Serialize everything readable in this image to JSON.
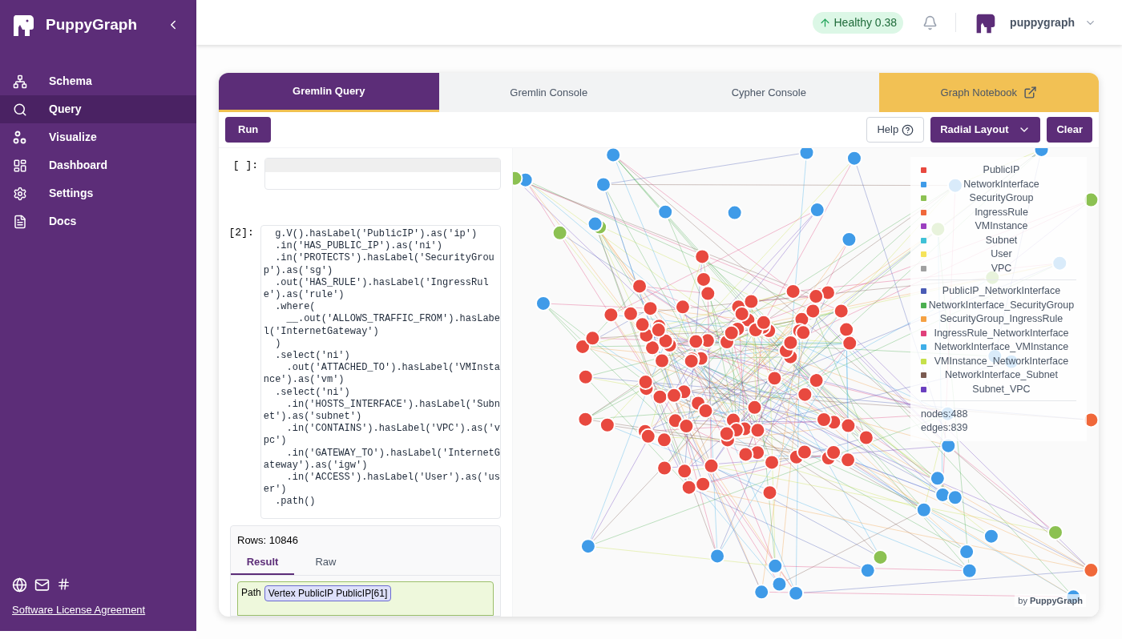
{
  "sidebar": {
    "brand": "PuppyGraph",
    "items": [
      {
        "label": "Schema",
        "selected": false
      },
      {
        "label": "Query",
        "selected": true
      },
      {
        "label": "Visualize",
        "selected": false
      },
      {
        "label": "Dashboard",
        "selected": false
      },
      {
        "label": "Settings",
        "selected": false
      },
      {
        "label": "Docs",
        "selected": false
      }
    ],
    "footer_link": "Software License Agreement"
  },
  "header": {
    "status": "Healthy 0.38",
    "user": "puppygraph"
  },
  "tabs": [
    {
      "label": "Gremlin Query",
      "selected": true,
      "kind": "tab"
    },
    {
      "label": "Gremlin Console",
      "selected": false,
      "kind": "tab"
    },
    {
      "label": "Cypher Console",
      "selected": false,
      "kind": "tab"
    },
    {
      "label": "Graph Notebook",
      "selected": false,
      "kind": "external"
    }
  ],
  "toolbar": {
    "run": "Run",
    "help": "Help",
    "layout": "Radial Layout",
    "clear": "Clear"
  },
  "cells": [
    {
      "prompt": "[ ]:"
    },
    {
      "prompt": "[2]:",
      "lines": [
        "  g.V().hasLabel('PublicIP').as('ip')",
        "  .in('HAS_PUBLIC_IP').as('ni')",
        "  .in('PROTECTS').hasLabel('SecurityGrou",
        "p').as('sg')",
        "  .out('HAS_RULE').hasLabel('IngressRul",
        "e').as('rule')",
        "  .where(",
        "    __.out('ALLOWS_TRAFFIC_FROM').hasLabe",
        "l('InternetGateway')",
        "  )",
        "  .select('ni')",
        "    .out('ATTACHED_TO').hasLabel('VMInsta",
        "nce').as('vm')",
        "  .select('ni')",
        "    .in('HOSTS_INTERFACE').hasLabel('Subn",
        "et').as('subnet')",
        "    .in('CONTAINS').hasLabel('VPC').as('v",
        "pc')",
        "    .in('GATEWAY_TO').hasLabel('InternetG",
        "ateway').as('igw')",
        "    .in('ACCESS').hasLabel('User').as('us",
        "er')",
        "  .path()"
      ]
    }
  ],
  "result": {
    "rows": "Rows: 10846",
    "tabs": [
      {
        "label": "Result",
        "selected": true
      },
      {
        "label": "Raw",
        "selected": false
      }
    ],
    "path_label": "Path",
    "chips": [
      "Vertex PublicIP PublicIP[61]"
    ]
  },
  "legend": {
    "vertices": [
      {
        "label": "PublicIP",
        "color": "#e8493f"
      },
      {
        "label": "NetworkInterface",
        "color": "#3f9be8"
      },
      {
        "label": "SecurityGroup",
        "color": "#8cc152"
      },
      {
        "label": "IngressRule",
        "color": "#f0683a"
      },
      {
        "label": "VMInstance",
        "color": "#9b3fbf"
      },
      {
        "label": "Subnet",
        "color": "#3fc1d6"
      },
      {
        "label": "User",
        "color": "#f5e35a"
      },
      {
        "label": "VPC",
        "color": "#a0a0a0"
      }
    ],
    "edges": [
      {
        "label": "PublicIP_NetworkInterface",
        "color": "#4a5bb5"
      },
      {
        "label": "NetworkInterface_SecurityGroup",
        "color": "#4caf50"
      },
      {
        "label": "SecurityGroup_IngressRule",
        "color": "#f5a142"
      },
      {
        "label": "IngressRule_NetworkInterface",
        "color": "#e0407a"
      },
      {
        "label": "NetworkInterface_VMInstance",
        "color": "#3faee8"
      },
      {
        "label": "VMInstance_NetworkInterface",
        "color": "#c6e04a"
      },
      {
        "label": "NetworkInterface_Subnet",
        "color": "#7a5a50"
      },
      {
        "label": "Subnet_VPC",
        "color": "#6a3fbf"
      }
    ],
    "nodes": "nodes:488",
    "edges_count": "edges:839"
  },
  "credit": "by **PuppyGraph**"
}
